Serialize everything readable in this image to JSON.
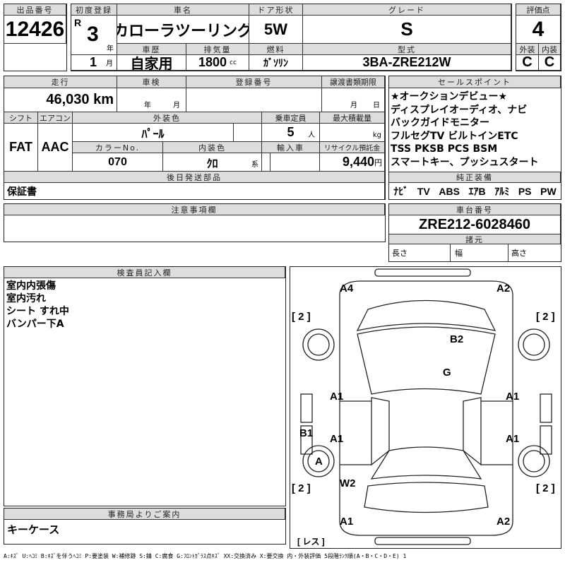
{
  "lot": {
    "header": "出品番号",
    "value": "12426"
  },
  "first_reg": {
    "header": "初度登録",
    "era": "R",
    "year": "3",
    "year_unit": "年",
    "month": "1",
    "month_unit": "月"
  },
  "car_name": {
    "header": "車名",
    "value": "カローラツーリング"
  },
  "door": {
    "header": "ドア形状",
    "value": "5W"
  },
  "grade": {
    "header": "グレード",
    "value": "S"
  },
  "history": {
    "header": "車歴",
    "value": "自家用"
  },
  "displacement": {
    "header": "排気量",
    "value": "1800",
    "unit": "cc"
  },
  "fuel": {
    "header": "燃料",
    "value": "ｶﾞｿﾘﾝ"
  },
  "model": {
    "header": "型式",
    "value": "3BA-ZRE212W"
  },
  "score": {
    "header": "評価点",
    "value": "4",
    "ext_header": "外装",
    "int_header": "内装",
    "ext": "C",
    "int": "C"
  },
  "mileage": {
    "header": "走行",
    "value": "46,030 km"
  },
  "inspection": {
    "header": "車検",
    "year_unit": "年",
    "month_unit": "月"
  },
  "reg_no": {
    "header": "登録番号"
  },
  "transfer": {
    "header": "譲渡書類期限",
    "month_unit": "月",
    "day_unit": "日"
  },
  "shift": {
    "header": "シフト",
    "value": "FAT"
  },
  "aircon": {
    "header": "エアコン",
    "value": "AAC"
  },
  "ext_color": {
    "header": "外装色",
    "value": "ﾊﾟｰﾙ"
  },
  "capacity": {
    "header": "乗車定員",
    "value": "5",
    "unit": "人"
  },
  "max_load": {
    "header": "最大積載量",
    "unit": "kg"
  },
  "color_no": {
    "header": "カラーNo.",
    "value": "070"
  },
  "int_color": {
    "header": "内装色",
    "value": "ｸﾛ",
    "unit": "系"
  },
  "import": {
    "header": "輸入車"
  },
  "recycle": {
    "header": "リサイクル預託金",
    "value": "9,440",
    "unit": "円"
  },
  "later_parts": {
    "header": "後日発送部品",
    "value": "保証書"
  },
  "sale_points": {
    "header": "セールスポイント",
    "lines": [
      "★オークションデビュー★",
      "ディスプレイオーディオ、ナビ",
      "バックガイドモニター",
      "フルセグTV ビルトインETC",
      "TSS PKSB PCS BSM",
      "スマートキー、プッシュスタート"
    ]
  },
  "equipment": {
    "header": "純正装備",
    "items": [
      "ﾅﾋﾞ",
      "TV",
      "ABS",
      "ｴｱB",
      "ｱﾙﾐ",
      "PS",
      "PW"
    ]
  },
  "notes": {
    "header": "注意事項欄"
  },
  "chassis": {
    "header": "車台番号",
    "value": "ZRE212-6028460",
    "spec_header": "諸元",
    "length": "長さ",
    "width": "幅",
    "height": "高さ"
  },
  "inspector": {
    "header": "検査員記入欄",
    "lines": [
      "室内内張傷",
      "室内汚れ",
      "シート すれ中",
      "バンパー下A"
    ]
  },
  "office": {
    "header": "事務局よりご案内",
    "value": "キーケース"
  },
  "diagram": {
    "marks": [
      "A4",
      "A2",
      "[ 2 ]",
      "[ 2 ]",
      "B2",
      "G",
      "A1",
      "A1",
      "A1",
      "A1",
      "B1",
      "A",
      "[ 2 ]",
      "[ 2 ]",
      "W2",
      "A1",
      "A2",
      "[ レス ]"
    ]
  },
  "legend": "A:ｷｽﾞ U:ﾍｺﾐ B:ｷｽﾞを伴うﾍｺﾐ P:要塗装 W:補修跡 S:錆 C:腐食 G:ﾌﾛﾝﾄｶﾞﾗｽ点ｷｽﾞ XX:交換済み X:要交換 内・外装評価 5段階ﾗﾝｸ順(A・B・C・D・E) 1"
}
